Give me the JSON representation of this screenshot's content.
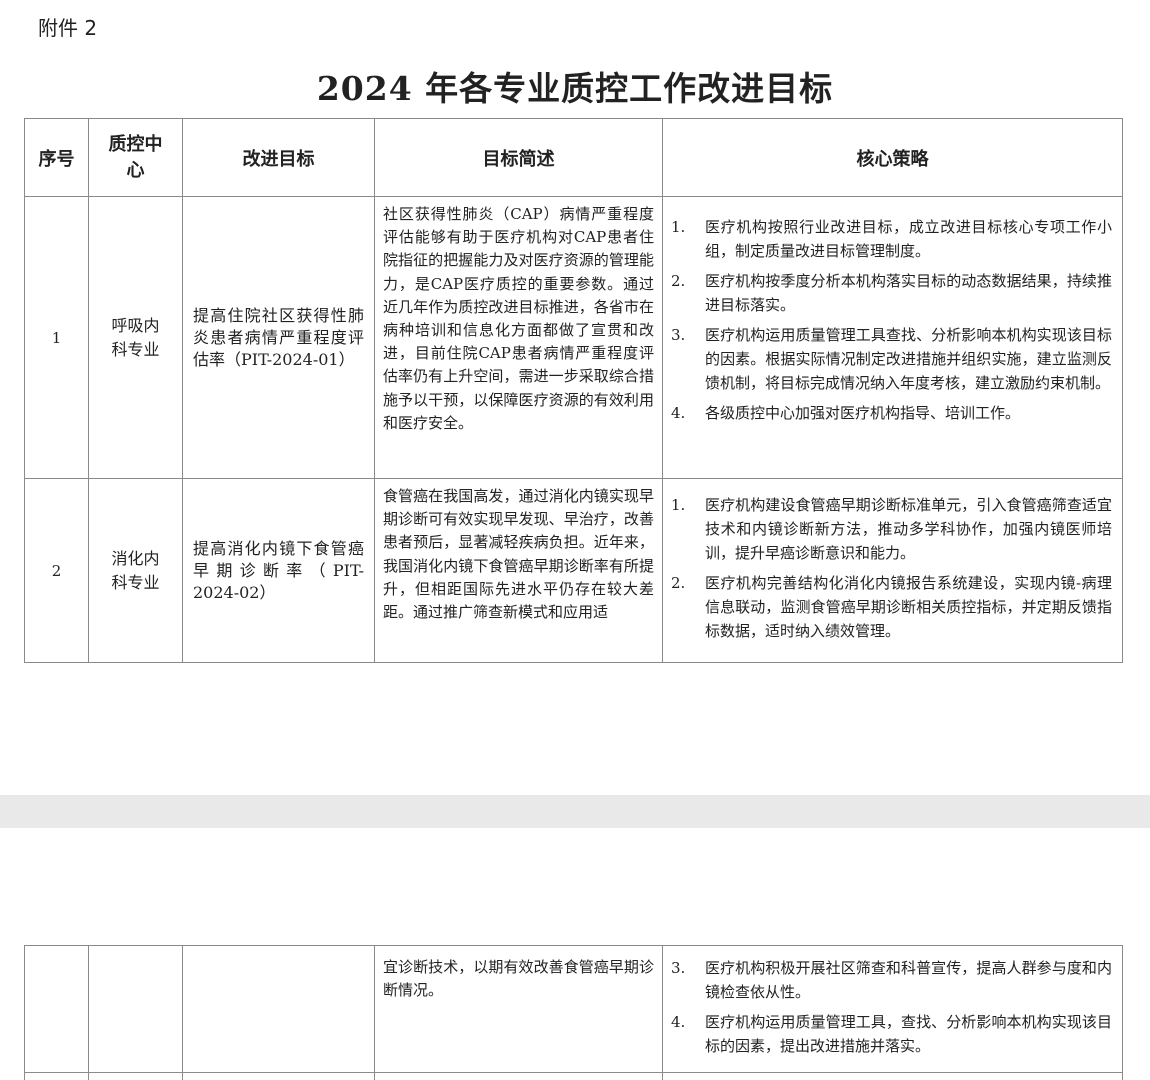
{
  "attachment_label": "附件 2",
  "title": "2024 年各专业质控工作改进目标",
  "headers": {
    "no": "序号",
    "center": "质控中心",
    "goal": "改进目标",
    "desc": "目标简述",
    "strategy": "核心策略"
  },
  "rows": [
    {
      "no": "1",
      "center": "呼吸内科专业",
      "goal": "提高住院社区获得性肺炎患者病情严重程度评估率（PIT-2024-01）",
      "desc": "社区获得性肺炎（CAP）病情严重程度评估能够有助于医疗机构对CAP患者住院指征的把握能力及对医疗资源的管理能力，是CAP医疗质控的重要参数。通过近几年作为质控改进目标推进，各省市在病种培训和信息化方面都做了宣贯和改进，目前住院CAP患者病情严重程度评估率仍有上升空间，需进一步采取综合措施予以干预，以保障医疗资源的有效利用和医疗安全。",
      "strategies": [
        {
          "num": "1.",
          "text": "医疗机构按照行业改进目标，成立改进目标核心专项工作小组，制定质量改进目标管理制度。"
        },
        {
          "num": "2.",
          "text": "医疗机构按季度分析本机构落实目标的动态数据结果，持续推进目标落实。"
        },
        {
          "num": "3.",
          "text": "医疗机构运用质量管理工具查找、分析影响本机构实现该目标的因素。根据实际情况制定改进措施并组织实施，建立监测反馈机制，将目标完成情况纳入年度考核，建立激励约束机制。"
        },
        {
          "num": "4.",
          "text": "各级质控中心加强对医疗机构指导、培训工作。"
        }
      ]
    },
    {
      "no": "2",
      "center": "消化内科专业",
      "goal": "提高消化内镜下食管癌早期诊断率（PIT-2024-02）",
      "desc": "食管癌在我国高发，通过消化内镜实现早期诊断可有效实现早发现、早治疗，改善患者预后，显著减轻疾病负担。近年来，我国消化内镜下食管癌早期诊断率有所提升，但相距国际先进水平仍存在较大差距。通过推广筛查新模式和应用适",
      "strategies": [
        {
          "num": "1.",
          "text": "医疗机构建设食管癌早期诊断标准单元，引入食管癌筛查适宜技术和内镜诊断新方法，推动多学科协作，加强内镜医师培训，提升早癌诊断意识和能力。"
        },
        {
          "num": "2.",
          "text": "医疗机构完善结构化消化内镜报告系统建设，实现内镜-病理信息联动，监测食管癌早期诊断相关质控指标，并定期反馈指标数据，适时纳入绩效管理。"
        }
      ]
    }
  ],
  "continued": {
    "desc": "宜诊断技术，以期有效改善食管癌早期诊断情况。",
    "strategies": [
      {
        "num": "3.",
        "text": "医疗机构积极开展社区筛查和科普宣传，提高人群参与度和内镜检查依从性。"
      },
      {
        "num": "4.",
        "text": "医疗机构运用质量管理工具，查找、分析影响本机构实现该目标的因素，提出改进措施并落实。"
      }
    ]
  }
}
